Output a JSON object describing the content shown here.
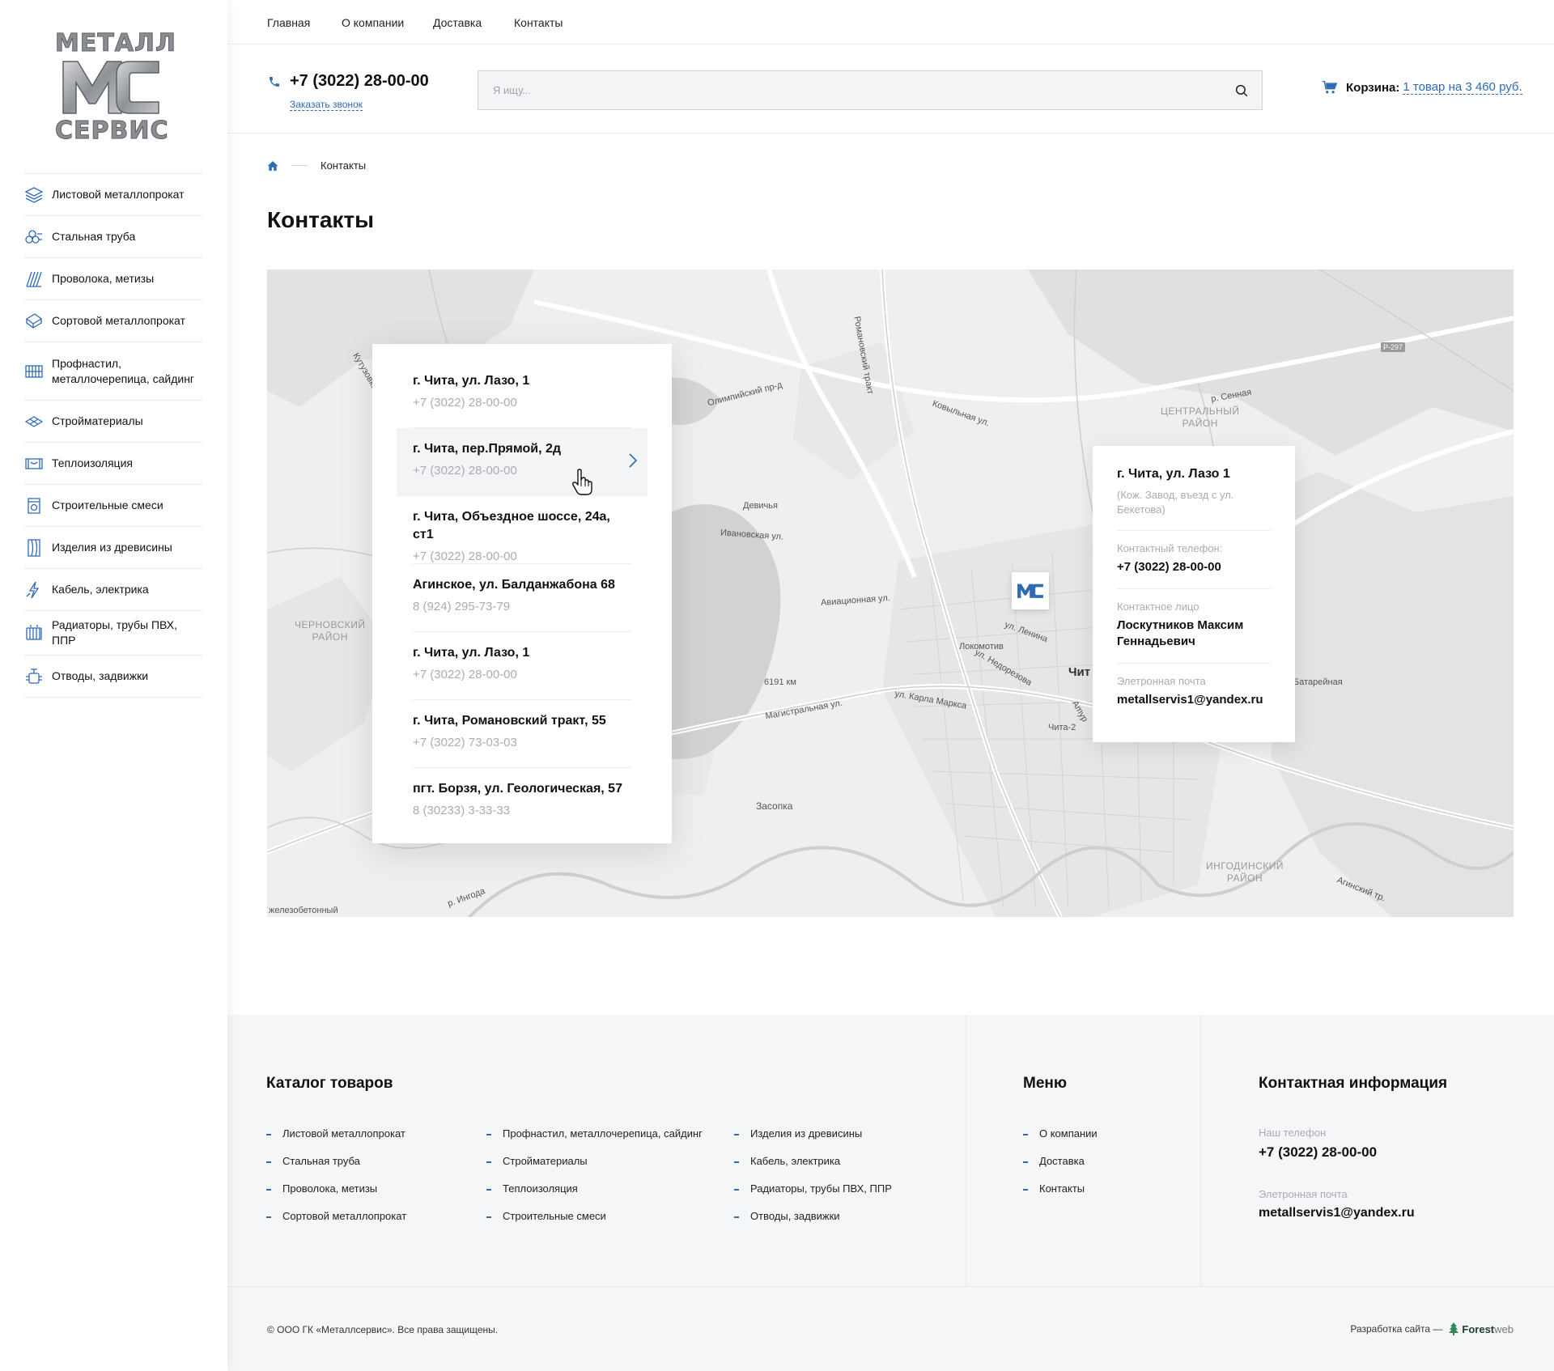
{
  "logo": {
    "top_text": "МЕТАЛЛ",
    "bottom_text": "СЕРВИС"
  },
  "sidebar": {
    "items": [
      {
        "label": "Листовой металлопрокат",
        "icon": "sheet-metal-icon"
      },
      {
        "label": "Стальная труба",
        "icon": "steel-pipe-icon"
      },
      {
        "label": "Проволока, метизы",
        "icon": "wire-icon"
      },
      {
        "label": "Сортовой металлопрокат",
        "icon": "section-metal-icon"
      },
      {
        "label": "Профнастил, металлочерепица, сайдинг",
        "icon": "profiled-sheet-icon"
      },
      {
        "label": "Стройматериалы",
        "icon": "building-materials-icon"
      },
      {
        "label": "Теплоизоляция",
        "icon": "insulation-icon"
      },
      {
        "label": "Строительные смеси",
        "icon": "dry-mix-icon"
      },
      {
        "label": "Изделия из древисины",
        "icon": "wood-icon"
      },
      {
        "label": "Кабель, электрика",
        "icon": "cable-icon"
      },
      {
        "label": "Радиаторы, трубы ПВХ, ППР",
        "icon": "radiator-icon"
      },
      {
        "label": "Отводы, задвижки",
        "icon": "valve-icon"
      }
    ]
  },
  "topnav": {
    "items": [
      "Главная",
      "О компании",
      "Доставка",
      "Контакты"
    ]
  },
  "header": {
    "phone": "+7 (3022) 28-00-00",
    "callback": "Заказать звонок",
    "search_placeholder": "Я ищу...",
    "cart_label": "Корзина:",
    "cart_value": "1 товар на 3 460 руб."
  },
  "breadcrumb": {
    "current": "Контакты"
  },
  "page_title": "Контакты",
  "map": {
    "districts": [
      "ЦЕНТРАЛЬНЫЙ\nРАЙОН",
      "ЧЕРНОВСКИЙ\nРАЙОН",
      "ИНГОДИНСКИЙ\nРАЙОН"
    ],
    "labels": [
      "Олимпийский пр-д",
      "Ковыльная ул.",
      "Романовский тракт",
      "Девичья",
      "Ивановская ул.",
      "Авиационная ул.",
      "Локомотив",
      "ул. Ленина",
      "Чит",
      "Чита-2",
      "6191 км",
      "Магистральная ул.",
      "ул. Карла Маркса",
      "Засопка",
      "Батарейная",
      "р. Сенная",
      "ул. Недорезова",
      "Агинский тр.",
      "р. Ингода",
      "железобетонный",
      "Кутузовка",
      "Amyр"
    ],
    "road_badge": "Р-297",
    "addresses": [
      {
        "title": "г. Чита, ул. Лазо, 1",
        "phone": "+7 (3022) 28-00-00"
      },
      {
        "title": "г. Чита, пер.Прямой, 2д",
        "phone": "+7 (3022) 28-00-00"
      },
      {
        "title": "г. Чита, Объездное шоссе, 24а, ст1",
        "phone": "+7 (3022) 28-00-00"
      },
      {
        "title": "Агинское, ул. Балданжабона 68",
        "phone": "8 (924) 295-73-79"
      },
      {
        "title": "г. Чита, ул. Лазо, 1",
        "phone": "+7 (3022) 28-00-00"
      },
      {
        "title": "г. Чита, Романовский тракт, 55",
        "phone": "+7 (3022) 73-03-03"
      },
      {
        "title": "пгт. Борзя, ул. Геологическая, 57",
        "phone": "8 (30233) 3-33-33"
      }
    ],
    "active_index": 1,
    "info": {
      "title": "г. Чита, ул. Лазо 1",
      "subtitle": "(Кож. Завод, въезд с ул. Бекетова)",
      "phone_label": "Контактный телефон:",
      "phone": "+7 (3022) 28-00-00",
      "person_label": "Контактное лицо",
      "person": "Лоскутников Максим Геннадьевич",
      "email_label": "Элетронная почта",
      "email": "metallservis1@yandex.ru"
    }
  },
  "footer": {
    "catalog_title": "Каталог товаров",
    "catalog_col1": [
      "Листовой металлопрокат",
      "Стальная труба",
      "Проволока, метизы",
      "Сортовой металлопрокат"
    ],
    "catalog_col2": [
      "Профнастил, металлочерепица, сайдинг",
      "Стройматериалы",
      "Теплоизоляция",
      "Строительные смеси"
    ],
    "catalog_col3": [
      "Изделия из древисины",
      "Кабель, электрика",
      "Радиаторы, трубы ПВХ, ППР",
      "Отводы, задвижки"
    ],
    "menu_title": "Меню",
    "menu": [
      "О компании",
      "Доставка",
      "Контакты"
    ],
    "contact_title": "Контактная информация",
    "phone_label": "Наш телефон",
    "phone": "+7 (3022) 28-00-00",
    "email_label": "Элетронная почта",
    "email": "metallservis1@yandex.ru",
    "copyright": "© ООО ГК «Металлсервис». Все права защищены.",
    "dev_label": "Разработка сайта —",
    "dev_brand": "Forest",
    "dev_brand2": "web"
  },
  "colors": {
    "accent": "#2f6bb5",
    "muted": "#a9adb3",
    "footer_bg": "#f5f6f8"
  }
}
